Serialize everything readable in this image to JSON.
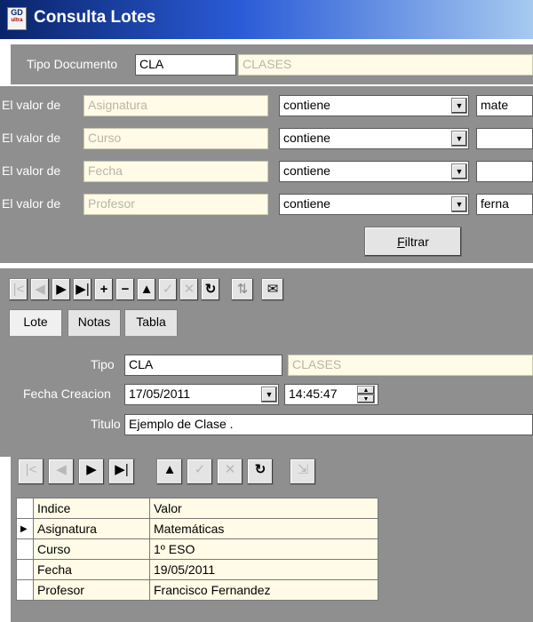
{
  "window": {
    "title": "Consulta Lotes",
    "logo_text_top": "GD",
    "logo_text_bottom": "ultra"
  },
  "tipo_documento": {
    "label": "Tipo Documento",
    "code": "CLA",
    "description": "CLASES"
  },
  "filters": [
    {
      "prefix": "El valor de",
      "field": "Asignatura",
      "operator": "contiene",
      "value": "mate"
    },
    {
      "prefix": "El valor de",
      "field": "Curso",
      "operator": "contiene",
      "value": ""
    },
    {
      "prefix": "El valor de",
      "field": "Fecha",
      "operator": "contiene",
      "value": ""
    },
    {
      "prefix": "El valor de",
      "field": "Profesor",
      "operator": "contiene",
      "value": "ferna"
    }
  ],
  "filter_button": {
    "label": "Filtrar",
    "accel": "F",
    "rest": "iltrar"
  },
  "navigator1": [
    "first-icon",
    "prior-icon",
    "next-icon",
    "last-icon",
    "insert-icon",
    "delete-icon",
    "edit-icon",
    "post-icon",
    "cancel-icon",
    "refresh-icon",
    "swap-icon",
    "mail-icon"
  ],
  "tabs": [
    "Lote",
    "Notas",
    "Tabla"
  ],
  "form": {
    "tipo_label": "Tipo",
    "tipo_code": "CLA",
    "tipo_desc": "CLASES",
    "fecha_label": "Fecha Creacion",
    "fecha_value": "17/05/2011",
    "hora_value": "14:45:47",
    "titulo_label": "Titulo",
    "titulo_value": "Ejemplo de Clase ."
  },
  "grid": {
    "columns": [
      "Indice",
      "Valor"
    ],
    "rows": [
      {
        "indice": "Asignatura",
        "valor": "Matemáticas",
        "current": true
      },
      {
        "indice": "Curso",
        "valor": "1º ESO",
        "current": false
      },
      {
        "indice": "Fecha",
        "valor": "19/05/2011",
        "current": false
      },
      {
        "indice": "Profesor",
        "valor": "Francisco Fernandez",
        "current": false
      }
    ]
  },
  "colors": {
    "panel": "#8f8f8f",
    "readonly_bg": "#fffbe6",
    "titlebar": "#0a246a"
  }
}
